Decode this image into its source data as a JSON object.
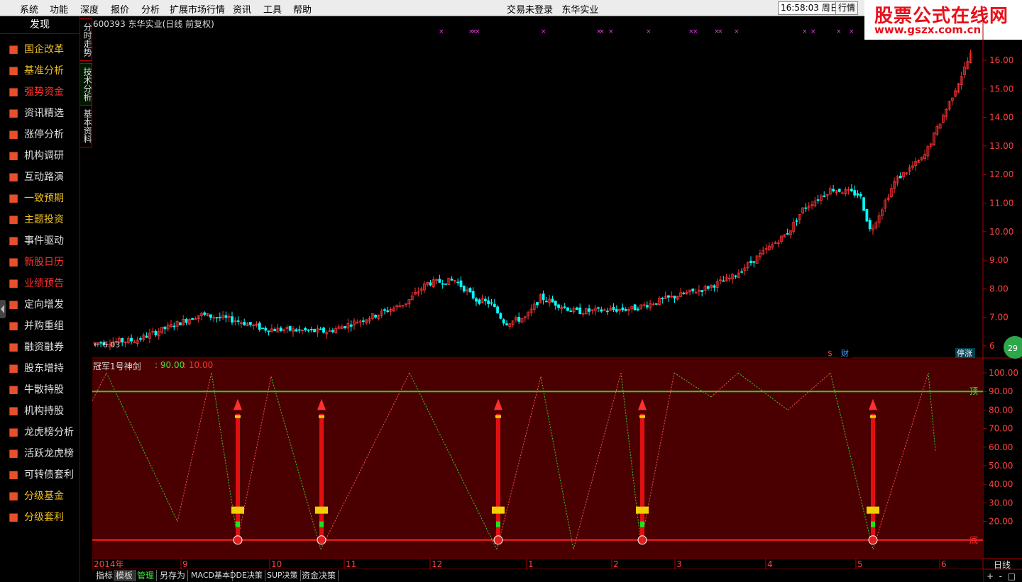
{
  "menu": [
    "系统",
    "功能",
    "深度",
    "报价",
    "分析",
    "扩展市场行情",
    "资讯",
    "工具",
    "帮助"
  ],
  "app_title": "交易未登录   东华实业",
  "clock": "16:58:03 周日",
  "hq_button": "行情",
  "brand": {
    "name": "股票公式在线网",
    "url": "www.gszx.com.cn"
  },
  "sidebar": {
    "header": "发现",
    "items": [
      {
        "label": "国企改革",
        "color": "#f0c020",
        "icon": "chart-up-icon"
      },
      {
        "label": "基准分析",
        "color": "#f0c020",
        "icon": "coins-icon"
      },
      {
        "label": "强势资金",
        "color": "#ff3030",
        "icon": "briefcase-icon"
      },
      {
        "label": "资讯精选",
        "color": "#e0e0e0",
        "icon": "dollar-circle-icon"
      },
      {
        "label": "涨停分析",
        "color": "#e0e0e0",
        "icon": "chart-up-icon"
      },
      {
        "label": "机构调研",
        "color": "#e0e0e0",
        "icon": "gear-icon"
      },
      {
        "label": "互动路演",
        "color": "#e0e0e0",
        "icon": "line-chart-icon"
      },
      {
        "label": "一致预期",
        "color": "#f0c020",
        "icon": "handshake-icon"
      },
      {
        "label": "主题投资",
        "color": "#f0c020",
        "icon": "umbrella-icon"
      },
      {
        "label": "事件驱动",
        "color": "#e0e0e0",
        "icon": "money-bag-icon"
      },
      {
        "label": "新股日历",
        "color": "#ff3030",
        "icon": "location-pin-icon"
      },
      {
        "label": "业绩预告",
        "color": "#ff3030",
        "icon": "wallet-icon"
      },
      {
        "label": "定向增发",
        "color": "#e0e0e0",
        "icon": "clock-icon"
      },
      {
        "label": "并购重组",
        "color": "#e0e0e0",
        "icon": "piggy-bank-icon"
      },
      {
        "label": "融资融券",
        "color": "#e0e0e0",
        "icon": "car-icon"
      },
      {
        "label": "股东增持",
        "color": "#e0e0e0",
        "icon": "dollar-doc-icon"
      },
      {
        "label": "牛散持股",
        "color": "#e0e0e0",
        "icon": "person-pin-icon"
      },
      {
        "label": "机构持股",
        "color": "#e0e0e0",
        "icon": "umbrella-icon"
      },
      {
        "label": "龙虎榜分析",
        "color": "#e0e0e0",
        "icon": "bar-chart-icon"
      },
      {
        "label": "活跃龙虎榜",
        "color": "#e0e0e0",
        "icon": "person-icon"
      },
      {
        "label": "可转债套利",
        "color": "#e0e0e0",
        "icon": "wallet-icon"
      },
      {
        "label": "分级基金",
        "color": "#f0c020",
        "icon": "piggy-bank-icon"
      },
      {
        "label": "分级套利",
        "color": "#f0c020",
        "icon": "wallet-icon"
      }
    ]
  },
  "vertical_tabs": [
    "分时走势",
    "技术分析",
    "基本资料"
  ],
  "chart": {
    "stock_title": "600393 东华实业(日线 前复权)",
    "low_marker": "6.03",
    "badges": {
      "cai": "财",
      "tingzhang": "停涨",
      "circle": "29"
    },
    "price_axis": [
      "16.00",
      "15.00",
      "14.00",
      "13.00",
      "12.00",
      "11.00",
      "10.00",
      "9.00",
      "8.00",
      "7.00",
      "6"
    ],
    "indicator": {
      "name": "冠军1号神剑",
      "value_green": ": 90.00",
      "value_red": ": 10.00",
      "axis": [
        "100.00",
        "90.00",
        "80.00",
        "70.00",
        "60.00",
        "50.00",
        "40.00",
        "30.00",
        "20.00"
      ],
      "top_label": "顶",
      "bottom_label": "底"
    },
    "time_axis": [
      "2014年",
      "9",
      "10",
      "11",
      "12",
      "1",
      "2",
      "3",
      "4",
      "5",
      "6"
    ],
    "period": "日线"
  },
  "bottom_tabs": [
    "指标",
    "模板",
    "管理",
    "另存为",
    "MACD基本",
    "DDE决策",
    "SUP决策",
    "资金决策"
  ],
  "zoom_controls": "+  -  □",
  "colors": {
    "up": "#ff3333",
    "down": "#00ffff",
    "grid_red": "#b00000",
    "ind_bg": "#4a0000",
    "green_line": "#2ad02a"
  }
}
